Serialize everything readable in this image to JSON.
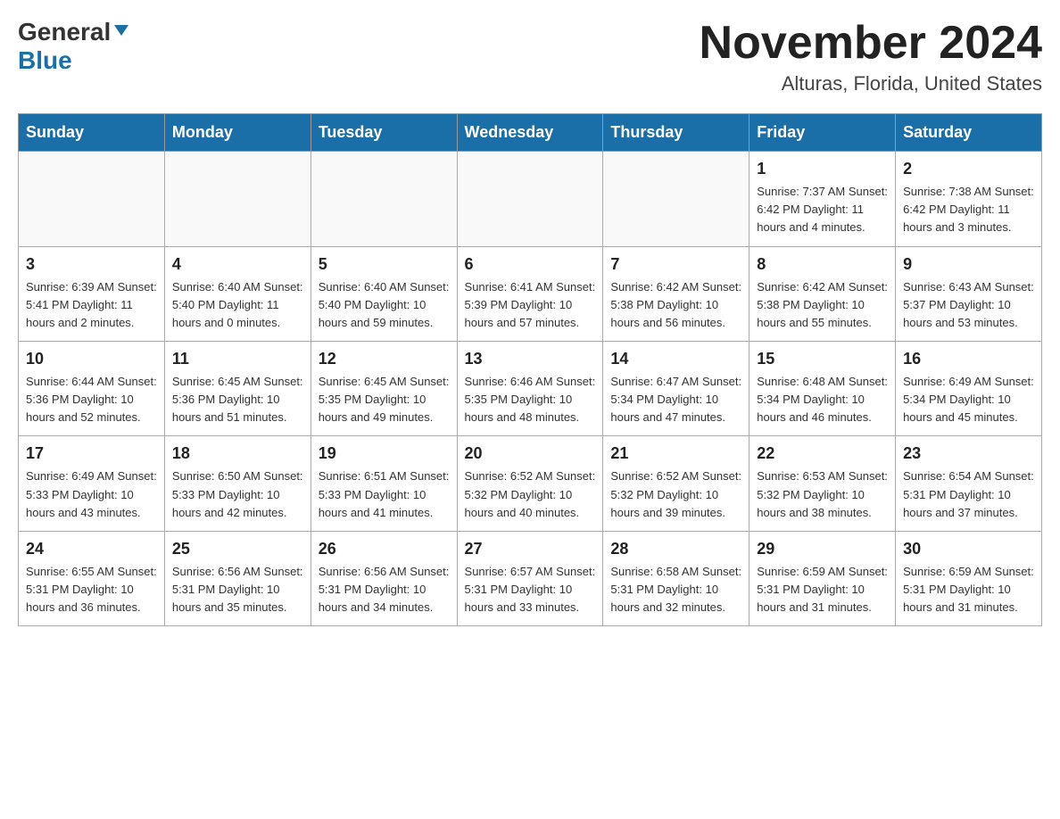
{
  "header": {
    "logo_general": "General",
    "logo_blue": "Blue",
    "month_year": "November 2024",
    "location": "Alturas, Florida, United States"
  },
  "weekdays": [
    "Sunday",
    "Monday",
    "Tuesday",
    "Wednesday",
    "Thursday",
    "Friday",
    "Saturday"
  ],
  "weeks": [
    [
      {
        "day": "",
        "info": ""
      },
      {
        "day": "",
        "info": ""
      },
      {
        "day": "",
        "info": ""
      },
      {
        "day": "",
        "info": ""
      },
      {
        "day": "",
        "info": ""
      },
      {
        "day": "1",
        "info": "Sunrise: 7:37 AM\nSunset: 6:42 PM\nDaylight: 11 hours and 4 minutes."
      },
      {
        "day": "2",
        "info": "Sunrise: 7:38 AM\nSunset: 6:42 PM\nDaylight: 11 hours and 3 minutes."
      }
    ],
    [
      {
        "day": "3",
        "info": "Sunrise: 6:39 AM\nSunset: 5:41 PM\nDaylight: 11 hours and 2 minutes."
      },
      {
        "day": "4",
        "info": "Sunrise: 6:40 AM\nSunset: 5:40 PM\nDaylight: 11 hours and 0 minutes."
      },
      {
        "day": "5",
        "info": "Sunrise: 6:40 AM\nSunset: 5:40 PM\nDaylight: 10 hours and 59 minutes."
      },
      {
        "day": "6",
        "info": "Sunrise: 6:41 AM\nSunset: 5:39 PM\nDaylight: 10 hours and 57 minutes."
      },
      {
        "day": "7",
        "info": "Sunrise: 6:42 AM\nSunset: 5:38 PM\nDaylight: 10 hours and 56 minutes."
      },
      {
        "day": "8",
        "info": "Sunrise: 6:42 AM\nSunset: 5:38 PM\nDaylight: 10 hours and 55 minutes."
      },
      {
        "day": "9",
        "info": "Sunrise: 6:43 AM\nSunset: 5:37 PM\nDaylight: 10 hours and 53 minutes."
      }
    ],
    [
      {
        "day": "10",
        "info": "Sunrise: 6:44 AM\nSunset: 5:36 PM\nDaylight: 10 hours and 52 minutes."
      },
      {
        "day": "11",
        "info": "Sunrise: 6:45 AM\nSunset: 5:36 PM\nDaylight: 10 hours and 51 minutes."
      },
      {
        "day": "12",
        "info": "Sunrise: 6:45 AM\nSunset: 5:35 PM\nDaylight: 10 hours and 49 minutes."
      },
      {
        "day": "13",
        "info": "Sunrise: 6:46 AM\nSunset: 5:35 PM\nDaylight: 10 hours and 48 minutes."
      },
      {
        "day": "14",
        "info": "Sunrise: 6:47 AM\nSunset: 5:34 PM\nDaylight: 10 hours and 47 minutes."
      },
      {
        "day": "15",
        "info": "Sunrise: 6:48 AM\nSunset: 5:34 PM\nDaylight: 10 hours and 46 minutes."
      },
      {
        "day": "16",
        "info": "Sunrise: 6:49 AM\nSunset: 5:34 PM\nDaylight: 10 hours and 45 minutes."
      }
    ],
    [
      {
        "day": "17",
        "info": "Sunrise: 6:49 AM\nSunset: 5:33 PM\nDaylight: 10 hours and 43 minutes."
      },
      {
        "day": "18",
        "info": "Sunrise: 6:50 AM\nSunset: 5:33 PM\nDaylight: 10 hours and 42 minutes."
      },
      {
        "day": "19",
        "info": "Sunrise: 6:51 AM\nSunset: 5:33 PM\nDaylight: 10 hours and 41 minutes."
      },
      {
        "day": "20",
        "info": "Sunrise: 6:52 AM\nSunset: 5:32 PM\nDaylight: 10 hours and 40 minutes."
      },
      {
        "day": "21",
        "info": "Sunrise: 6:52 AM\nSunset: 5:32 PM\nDaylight: 10 hours and 39 minutes."
      },
      {
        "day": "22",
        "info": "Sunrise: 6:53 AM\nSunset: 5:32 PM\nDaylight: 10 hours and 38 minutes."
      },
      {
        "day": "23",
        "info": "Sunrise: 6:54 AM\nSunset: 5:31 PM\nDaylight: 10 hours and 37 minutes."
      }
    ],
    [
      {
        "day": "24",
        "info": "Sunrise: 6:55 AM\nSunset: 5:31 PM\nDaylight: 10 hours and 36 minutes."
      },
      {
        "day": "25",
        "info": "Sunrise: 6:56 AM\nSunset: 5:31 PM\nDaylight: 10 hours and 35 minutes."
      },
      {
        "day": "26",
        "info": "Sunrise: 6:56 AM\nSunset: 5:31 PM\nDaylight: 10 hours and 34 minutes."
      },
      {
        "day": "27",
        "info": "Sunrise: 6:57 AM\nSunset: 5:31 PM\nDaylight: 10 hours and 33 minutes."
      },
      {
        "day": "28",
        "info": "Sunrise: 6:58 AM\nSunset: 5:31 PM\nDaylight: 10 hours and 32 minutes."
      },
      {
        "day": "29",
        "info": "Sunrise: 6:59 AM\nSunset: 5:31 PM\nDaylight: 10 hours and 31 minutes."
      },
      {
        "day": "30",
        "info": "Sunrise: 6:59 AM\nSunset: 5:31 PM\nDaylight: 10 hours and 31 minutes."
      }
    ]
  ]
}
